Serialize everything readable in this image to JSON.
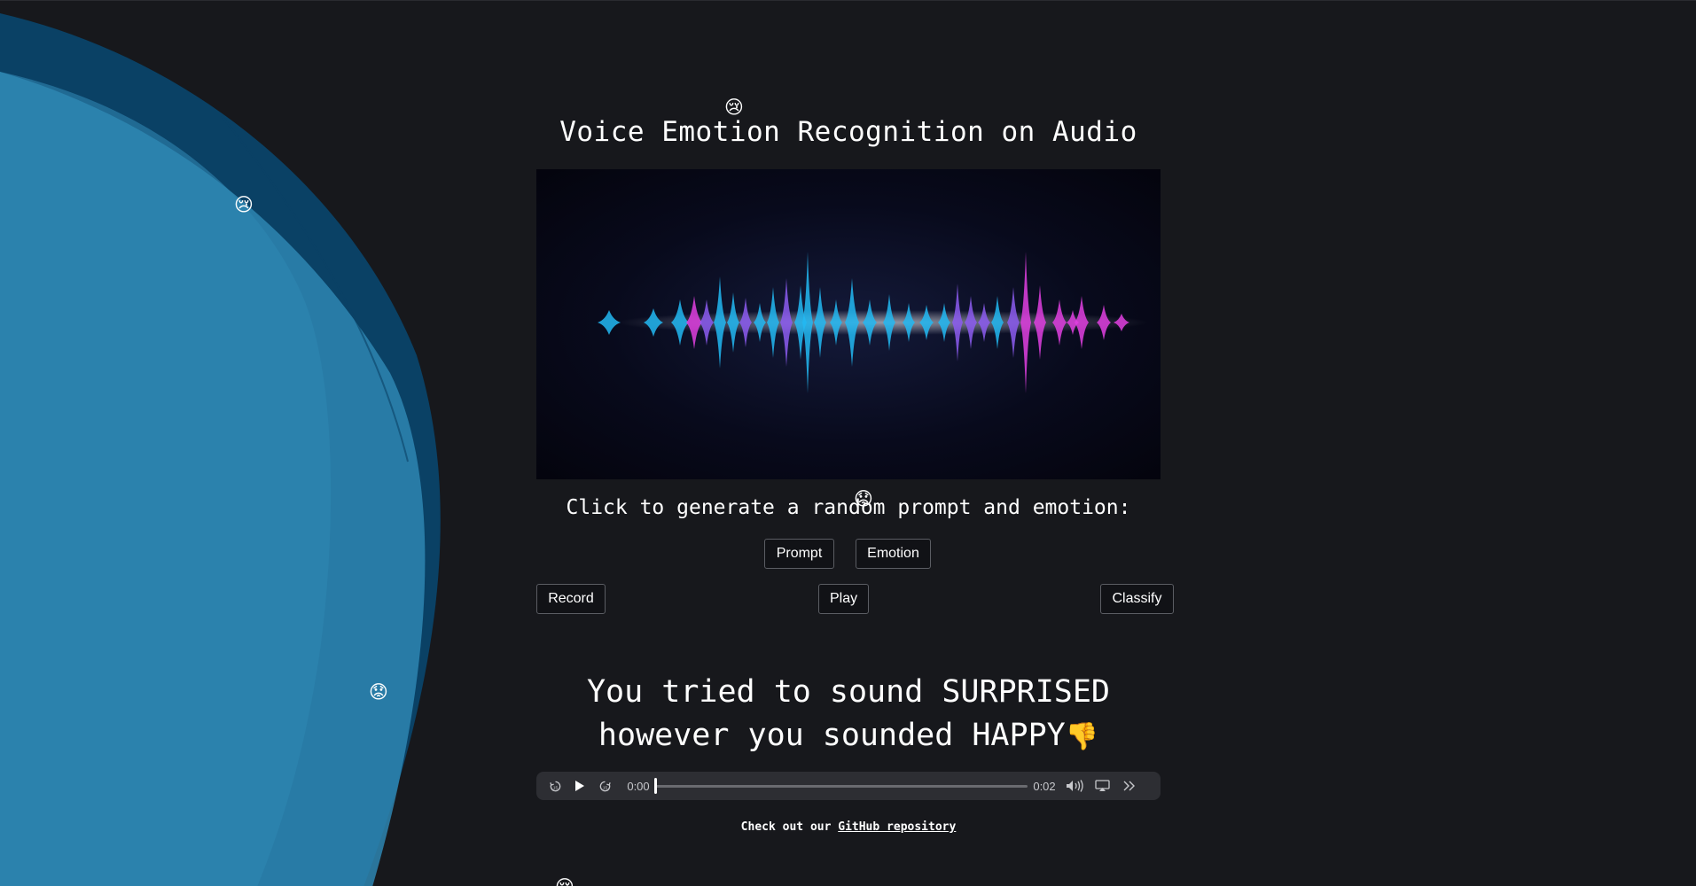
{
  "title": "Voice Emotion Recognition on Audio",
  "instruction": "Click to generate a random prompt and emotion:",
  "buttons": {
    "prompt": "Prompt",
    "emotion": "Emotion",
    "record": "Record",
    "play": "Play",
    "classify": "Classify"
  },
  "result": {
    "line1": "You tried to sound SURPRISED",
    "line2": "however you sounded HAPPY",
    "verdict_emoji": "👎"
  },
  "audio_player": {
    "current_time": "0:00",
    "duration": "0:02",
    "progress": 0.0
  },
  "footer": {
    "text": "Check out our ",
    "link_text": "GitHub repository"
  },
  "floating_emojis": {
    "title_emoji": "😢",
    "left_emoji_1": "😢",
    "left_emoji_2": "😟",
    "center_emoji": "😟",
    "bottom_emoji": "😢"
  },
  "colors": {
    "background": "#17181c",
    "blob_outer": "#0a4165",
    "blob_inner": "#2e86b2",
    "wave_cyan": "#22b8f2",
    "wave_violet": "#8c5cf0",
    "wave_magenta": "#e040e0"
  }
}
